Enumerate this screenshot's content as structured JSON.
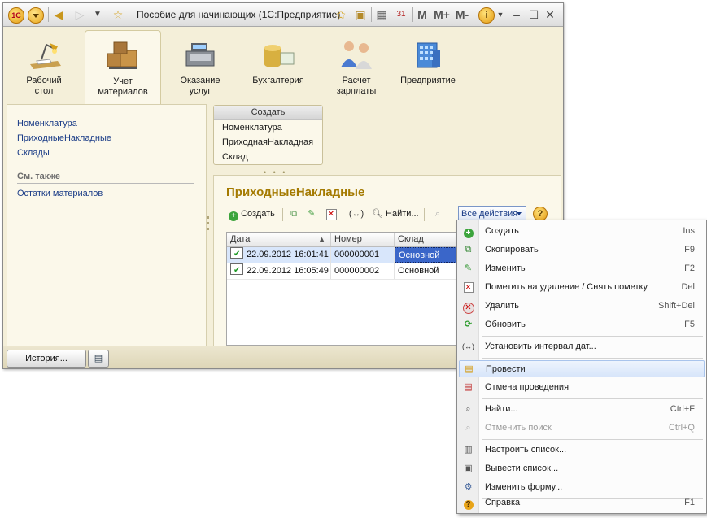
{
  "window": {
    "title": "Пособие для начинающих  (1С:Предприятие)"
  },
  "titlebar_icons": [
    "1c-logo-icon",
    "dropdown-icon",
    "back-icon",
    "forward-icon",
    "history-dropdown-icon",
    "favorite-star-icon",
    "add-favorite-icon",
    "history-clock-icon",
    "calculator-icon",
    "calendar-icon",
    "memory-M",
    "memory-M+",
    "memory-M-",
    "info-icon",
    "minimize-icon",
    "maximize-icon",
    "close-icon"
  ],
  "memory": {
    "m": "M",
    "mplus": "M+",
    "mminus": "M-"
  },
  "sections": [
    {
      "id": "desktop",
      "label1": "Рабочий",
      "label2": "стол"
    },
    {
      "id": "materials",
      "label1": "Учет",
      "label2": "материалов",
      "active": true
    },
    {
      "id": "services",
      "label1": "Оказание",
      "label2": "услуг"
    },
    {
      "id": "accounting",
      "label1": "Бухгалтерия",
      "label2": ""
    },
    {
      "id": "payroll",
      "label1": "Расчет",
      "label2": "зарплаты"
    },
    {
      "id": "enterprise",
      "label1": "Предприятие",
      "label2": ""
    }
  ],
  "navigation": {
    "items": [
      "Номенклатура",
      "ПриходныеНакладные",
      "Склады"
    ],
    "see_also_title": "См. также",
    "see_also_items": [
      "Остатки материалов"
    ]
  },
  "create_panel": {
    "title": "Создать",
    "items": [
      "Номенклатура",
      "ПриходнаяНакладная",
      "Склад"
    ]
  },
  "list": {
    "title": "ПриходныеНакладные",
    "toolbar": {
      "create": "Создать",
      "find": "Найти...",
      "all_actions": "Все действия",
      "help": "?",
      "interval": "(↔)"
    },
    "columns": [
      "Дата",
      "Номер",
      "Склад"
    ],
    "rows": [
      {
        "date": "22.09.2012 16:01:41",
        "number": "000000001",
        "warehouse": "Основной"
      },
      {
        "date": "22.09.2012 16:05:49",
        "number": "000000002",
        "warehouse": "Основной"
      }
    ]
  },
  "bottom": {
    "history": "История..."
  },
  "menu": {
    "items": [
      {
        "label": "Создать",
        "shortcut": "Ins",
        "icon": "plus-icon"
      },
      {
        "label": "Скопировать",
        "shortcut": "F9",
        "icon": "copy-icon"
      },
      {
        "label": "Изменить",
        "shortcut": "F2",
        "icon": "pencil-icon"
      },
      {
        "label": "Пометить на удаление / Снять пометку",
        "shortcut": "Del",
        "icon": "mark-delete-icon"
      },
      {
        "label": "Удалить",
        "shortcut": "Shift+Del",
        "icon": "delete-icon"
      },
      {
        "label": "Обновить",
        "shortcut": "F5",
        "icon": "refresh-icon"
      },
      {
        "label": "Установить интервал дат...",
        "shortcut": "",
        "icon": "interval-icon"
      },
      {
        "label": "Провести",
        "shortcut": "",
        "icon": "post-icon",
        "highlighted": true
      },
      {
        "label": "Отмена проведения",
        "shortcut": "",
        "icon": "unpost-icon"
      },
      {
        "label": "Найти...",
        "shortcut": "Ctrl+F",
        "icon": "search-icon"
      },
      {
        "label": "Отменить поиск",
        "shortcut": "Ctrl+Q",
        "icon": "cancel-search-icon",
        "disabled": true
      },
      {
        "label": "Настроить список...",
        "shortcut": "",
        "icon": "settings-list-icon"
      },
      {
        "label": "Вывести список...",
        "shortcut": "",
        "icon": "print-list-icon"
      },
      {
        "label": "Изменить форму...",
        "shortcut": "",
        "icon": "edit-form-icon"
      },
      {
        "label": "Справка",
        "shortcut": "F1",
        "icon": "help-icon"
      }
    ]
  },
  "colors": {
    "panel_bg": "#f4efd9",
    "accent_title": "#a47a00",
    "link": "#1a3c87",
    "selection": "#3a66c9",
    "highlight": "#d7e5fa"
  }
}
